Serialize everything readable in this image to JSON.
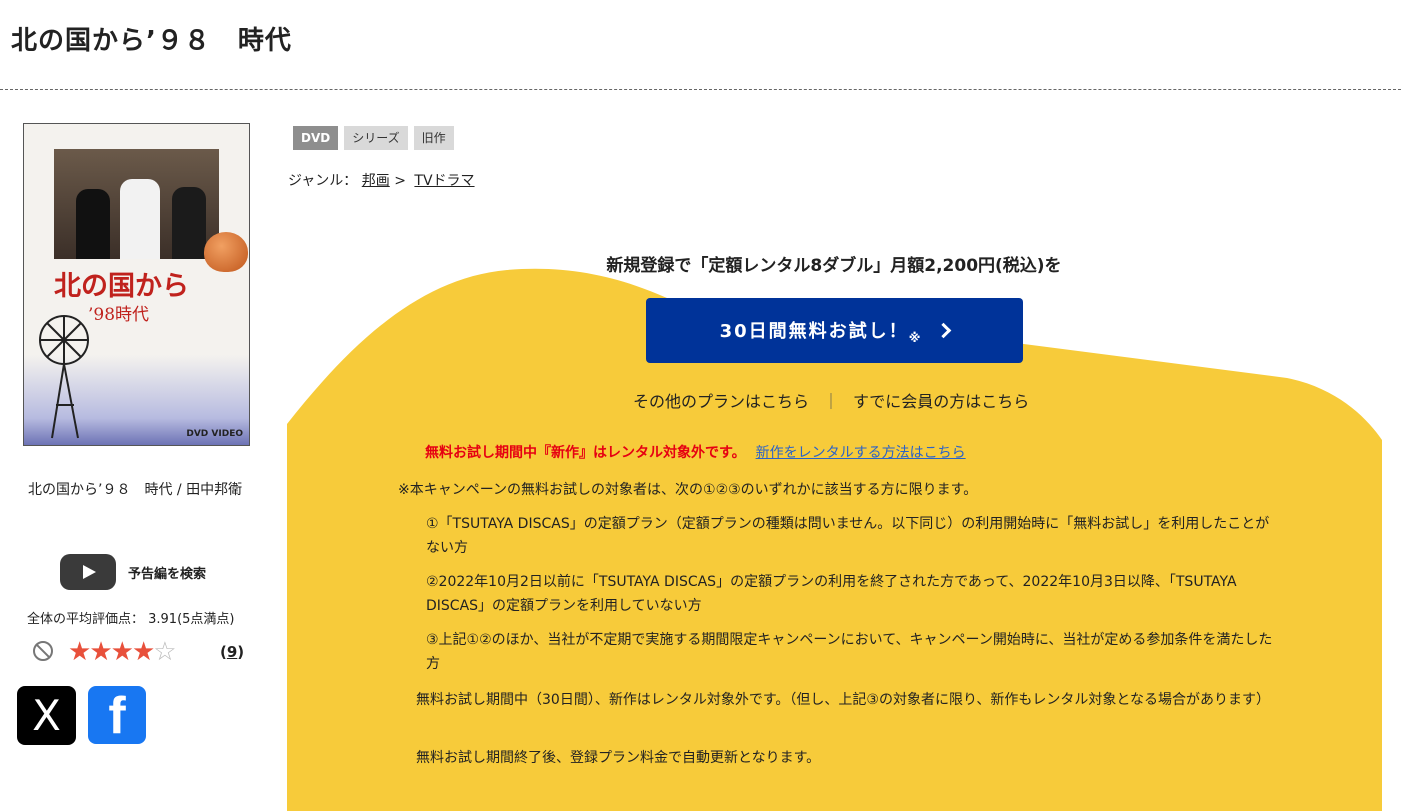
{
  "page": {
    "title": "北の国から’９８　時代"
  },
  "jacket": {
    "title_main": "北の国から",
    "title_sub": "’98時代",
    "logo": "DVD VIDEO"
  },
  "left": {
    "caption": "北の国から’９８　時代 / 田中邦衛",
    "trailer_label": "予告編を検索",
    "rating_text": "全体の平均評価点： 3.91(5点満点)",
    "stars": {
      "full": 4,
      "max": 5
    },
    "review_open": "(",
    "review_count": "9",
    "review_close": ")",
    "sns": {
      "x_label": "X",
      "fb_label": "f"
    }
  },
  "badges": [
    "DVD",
    "シリーズ",
    "旧作"
  ],
  "genre": {
    "label": "ジャンル：",
    "level1": "邦画",
    "sep": ">",
    "level2": "TVドラマ"
  },
  "campaign": {
    "headline": "新規登録で「定額レンタル8ダブル」月額2,200円(税込)を",
    "cta_label": "30日間無料お試し！",
    "cta_mark": "※",
    "other_plans": "その他のプランはこちら",
    "divider": "｜",
    "members": "すでに会員の方はこちら",
    "warn_red": "無料お試し期間中『新作』はレンタル対象外です。",
    "warn_link": "新作をレンタルする方法はこちら",
    "note_main": "※本キャンペーンの無料お試しの対象者は、次の①②③のいずれかに該当する方に限ります。",
    "cond1": "①「TSUTAYA DISCAS」の定額プラン（定額プランの種類は問いません。以下同じ）の利用開始時に「無料お試し」を利用したことがない方",
    "cond2": "②2022年10月2日以前に「TSUTAYA DISCAS」の定額プランの利用を終了された方であって、2022年10月3日以降、「TSUTAYA DISCAS」の定額プランを利用していない方",
    "cond3": "③上記①②のほか、当社が不定期で実施する期間限定キャンペーンにおいて、キャンペーン開始時に、当社が定める参加条件を満たした方",
    "para1": "無料お試し期間中（30日間）、新作はレンタル対象外です。（但し、上記③の対象者に限り、新作もレンタル対象となる場合があります）",
    "para2": "無料お試し期間終了後、登録プラン料金で自動更新となります。"
  },
  "colors": {
    "accent_yellow": "#f7cb3a",
    "cta_blue": "#003399",
    "warn_red": "#e60012",
    "link_blue": "#2a62c9"
  }
}
